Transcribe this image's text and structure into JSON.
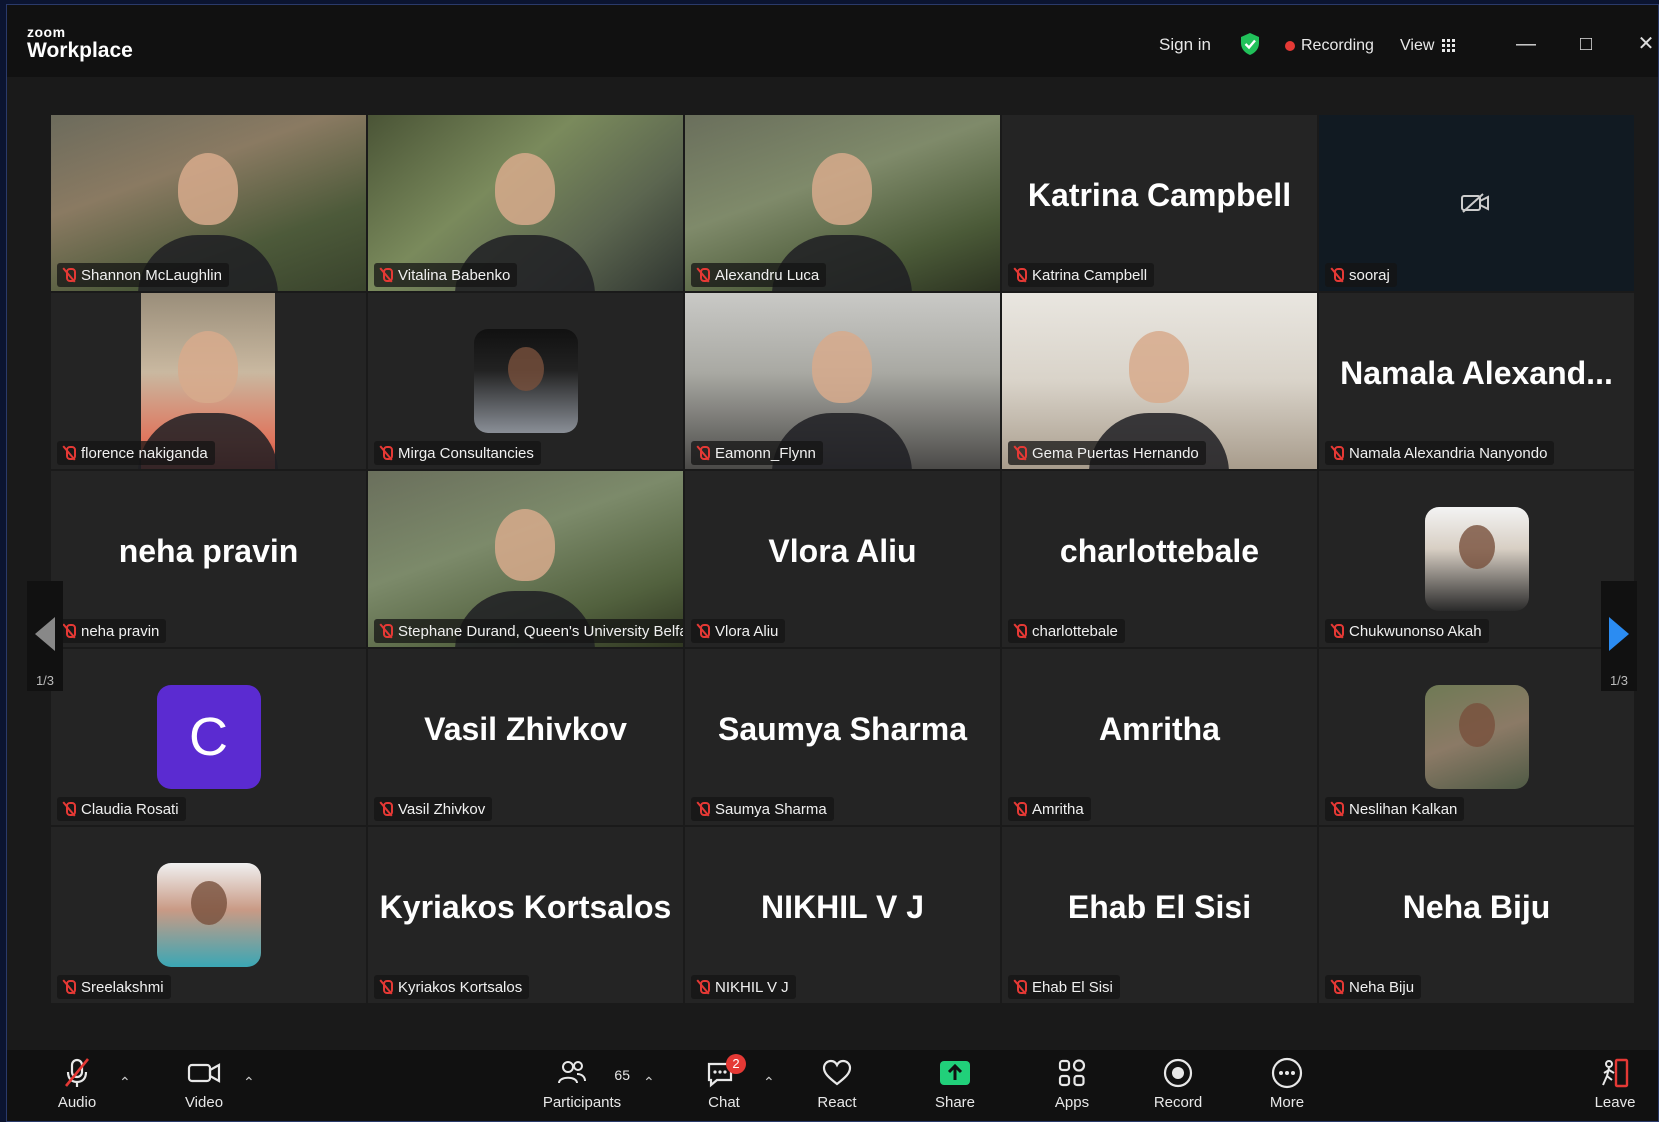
{
  "app": {
    "brand_small": "zoom",
    "brand_large": "Workplace"
  },
  "titlebar": {
    "sign_in": "Sign in",
    "recording": "Recording",
    "view": "View"
  },
  "page_indicator": {
    "left": "1/3",
    "right": "1/3"
  },
  "tiles": [
    {
      "name": "Shannon McLaughlin",
      "big": "",
      "kind": "video"
    },
    {
      "name": "Vitalina Babenko",
      "big": "",
      "kind": "video"
    },
    {
      "name": "Alexandru Luca",
      "big": "",
      "kind": "video"
    },
    {
      "name": "Katrina Campbell",
      "big": "Katrina Campbell",
      "kind": "name"
    },
    {
      "name": "sooraj",
      "big": "",
      "kind": "camoff"
    },
    {
      "name": "florence nakiganda",
      "big": "",
      "kind": "video"
    },
    {
      "name": "Mirga Consultancies",
      "big": "",
      "kind": "avatar"
    },
    {
      "name": "Eamonn_Flynn",
      "big": "",
      "kind": "video"
    },
    {
      "name": "Gema Puertas Hernando",
      "big": "",
      "kind": "video"
    },
    {
      "name": "Namala Alexandria Nanyondo",
      "big": "Namala  Alexand...",
      "kind": "name"
    },
    {
      "name": "neha pravin",
      "big": "neha pravin",
      "kind": "name"
    },
    {
      "name": "Stephane Durand, Queen's University Belfast",
      "big": "",
      "kind": "video"
    },
    {
      "name": "Vlora Aliu",
      "big": "Vlora Aliu",
      "kind": "name"
    },
    {
      "name": "charlottebale",
      "big": "charlottebale",
      "kind": "name"
    },
    {
      "name": "Chukwunonso Akah",
      "big": "",
      "kind": "avatar"
    },
    {
      "name": "Claudia Rosati",
      "big": "",
      "kind": "letter",
      "letter": "C"
    },
    {
      "name": "Vasil Zhivkov",
      "big": "Vasil Zhivkov",
      "kind": "name"
    },
    {
      "name": "Saumya Sharma",
      "big": "Saumya Sharma",
      "kind": "name"
    },
    {
      "name": "Amritha",
      "big": "Amritha",
      "kind": "name"
    },
    {
      "name": "Neslihan Kalkan",
      "big": "",
      "kind": "avatar"
    },
    {
      "name": "Sreelakshmi",
      "big": "",
      "kind": "avatar"
    },
    {
      "name": "Kyriakos Kortsalos",
      "big": "Kyriakos Kortsalos",
      "kind": "name"
    },
    {
      "name": "NIKHIL V J",
      "big": "NIKHIL V J",
      "kind": "name"
    },
    {
      "name": "Ehab El Sisi",
      "big": "Ehab El Sisi",
      "kind": "name"
    },
    {
      "name": "Neha Biju",
      "big": "Neha Biju",
      "kind": "name"
    }
  ],
  "toolbar": {
    "audio": "Audio",
    "video": "Video",
    "participants": "Participants",
    "participants_count": "65",
    "chat": "Chat",
    "chat_badge": "2",
    "react": "React",
    "share": "Share",
    "apps": "Apps",
    "record": "Record",
    "more": "More",
    "leave": "Leave"
  },
  "colors": {
    "accent": "#2b8cf2",
    "muted": "#e53935",
    "share": "#21d07a",
    "avatar_letter_bg": "#5b2bd1"
  }
}
